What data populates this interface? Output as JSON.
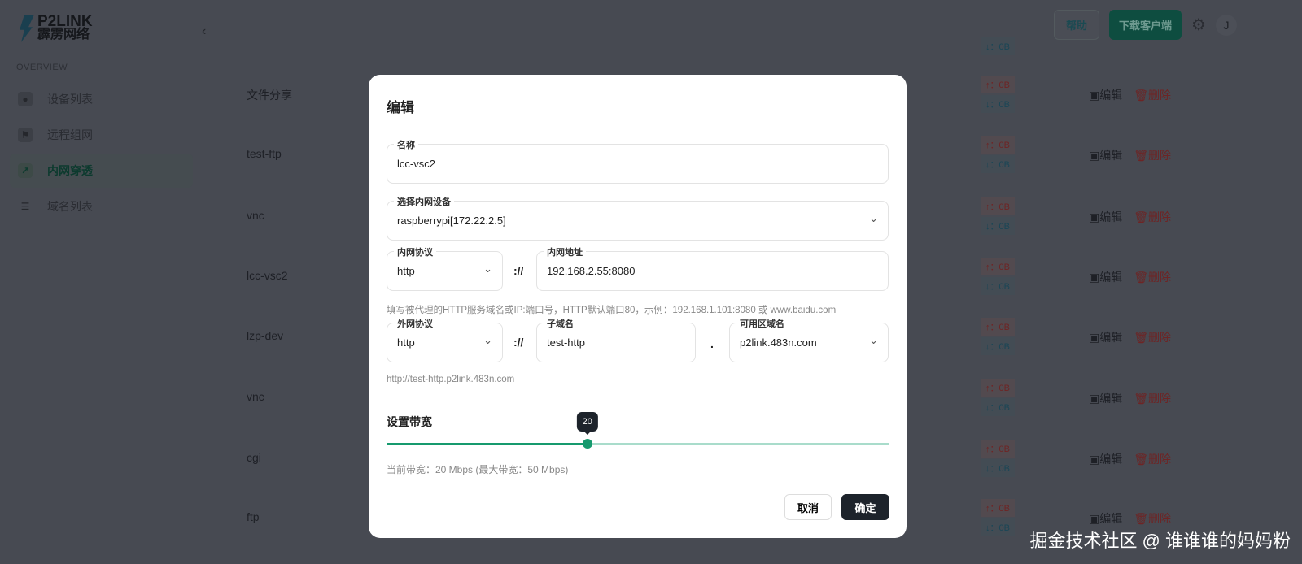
{
  "logo": {
    "en": "P2LINK",
    "cn": "霹雳网络"
  },
  "sidebar": {
    "section": "OVERVIEW",
    "items": [
      {
        "label": "设备列表"
      },
      {
        "label": "远程组网"
      },
      {
        "label": "内网穿透",
        "active": true
      },
      {
        "label": "域名列表"
      }
    ]
  },
  "topbar": {
    "help": "帮助",
    "download": "下载客户端",
    "avatar": "J"
  },
  "table": {
    "rows": [
      {
        "name": "文件分享",
        "up": "↑：0B",
        "down": "↓：0B"
      },
      {
        "name": "test-ftp",
        "up": "↑：0B",
        "down": "↓：0B"
      },
      {
        "name": "vnc",
        "up": "↑：0B",
        "down": "↓：0B"
      },
      {
        "name": "lcc-vsc2",
        "up": "↑：0B",
        "down": "↓：0B"
      },
      {
        "name": "lzp-dev",
        "up": "↑：0B",
        "down": "↓：0B"
      },
      {
        "name": "vnc",
        "up": "↑：0B",
        "down": "↓：0B"
      },
      {
        "name": "cgi",
        "up": "↑：0B",
        "down": "↓：0B"
      },
      {
        "name": "ftp",
        "up": "↑：0B",
        "down": "↓：0B"
      }
    ],
    "edit": "编辑",
    "delete": "删除",
    "partial_down": "↓：0B"
  },
  "modal": {
    "title": "编辑",
    "name": {
      "label": "名称",
      "value": "lcc-vsc2"
    },
    "device": {
      "label": "选择内网设备",
      "value": "raspberrypi[172.22.2.5]"
    },
    "inner_protocol": {
      "label": "内网协议",
      "value": "http"
    },
    "inner_address": {
      "label": "内网地址",
      "value": "192.168.2.55:8080"
    },
    "sep": "://",
    "hint": "填写被代理的HTTP服务域名或IP:端口号，HTTP默认端口80，示例：192.168.1.101:8080 或 www.baidu.com",
    "outer_protocol": {
      "label": "外网协议",
      "value": "http"
    },
    "subdomain": {
      "label": "子域名",
      "value": "test-http"
    },
    "dot": ".",
    "domain": {
      "label": "可用区域名",
      "value": "p2link.483n.com"
    },
    "url_preview": "http://test-http.p2link.483n.com",
    "bandwidth": {
      "label": "设置带宽",
      "value": 20,
      "max": 50,
      "value_label": "20",
      "text": "当前带宽：20 Mbps (最大带宽：50 Mbps)"
    },
    "cancel": "取消",
    "confirm": "确定"
  },
  "watermark": "掘金技术社区 @ 谁谁谁的妈妈粉"
}
